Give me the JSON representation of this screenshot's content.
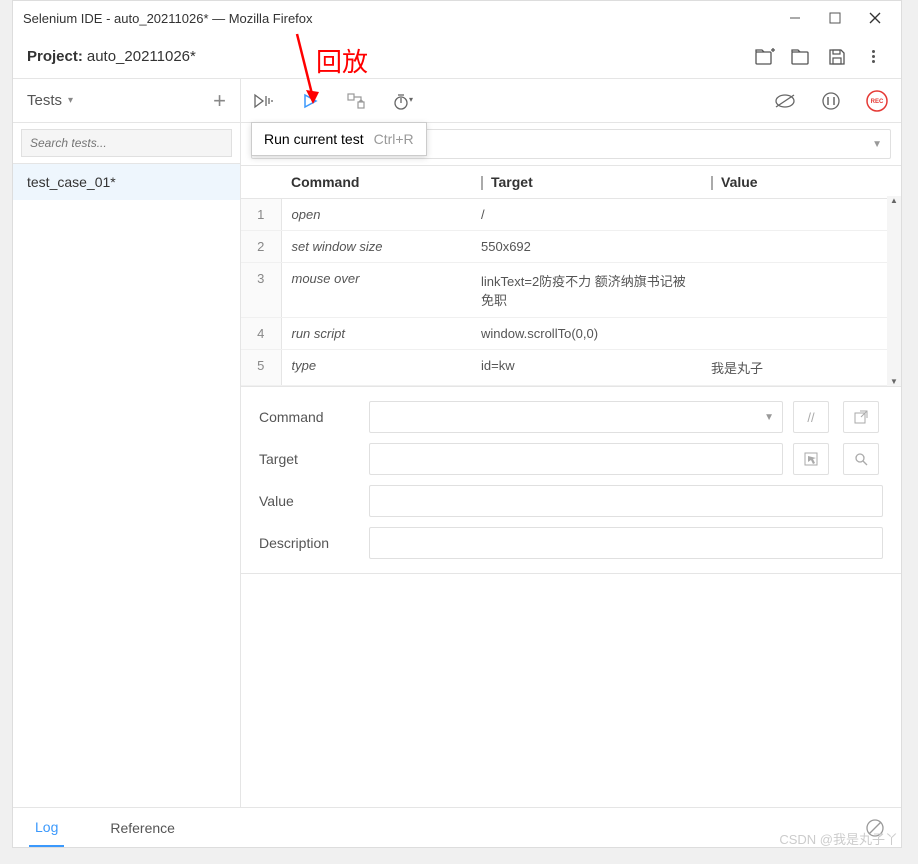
{
  "window": {
    "title": "Selenium IDE - auto_20211026* — Mozilla Firefox"
  },
  "project": {
    "label": "Project:",
    "name": "auto_20211026*"
  },
  "annotation": {
    "playback_label": "回放"
  },
  "sidebar": {
    "tests_label": "Tests",
    "search_placeholder": "Search tests...",
    "items": [
      "test_case_01*"
    ]
  },
  "tooltip": {
    "text": "Run current test",
    "shortcut": "Ctrl+R"
  },
  "record_btn": "REC",
  "table": {
    "headers": {
      "command": "Command",
      "target": "Target",
      "value": "Value"
    },
    "rows": [
      {
        "n": "1",
        "command": "open",
        "target": "/",
        "value": ""
      },
      {
        "n": "2",
        "command": "set window size",
        "target": "550x692",
        "value": ""
      },
      {
        "n": "3",
        "command": "mouse over",
        "target": "linkText=2防疫不力 额济纳旗书记被免职",
        "value": ""
      },
      {
        "n": "4",
        "command": "run script",
        "target": "window.scrollTo(0,0)",
        "value": ""
      },
      {
        "n": "5",
        "command": "type",
        "target": "id=kw",
        "value": "我是丸子"
      }
    ]
  },
  "editor": {
    "command_label": "Command",
    "target_label": "Target",
    "value_label": "Value",
    "description_label": "Description",
    "slash_btn": "//"
  },
  "tabs": {
    "log": "Log",
    "reference": "Reference"
  },
  "watermark": "CSDN @我是丸子丫"
}
